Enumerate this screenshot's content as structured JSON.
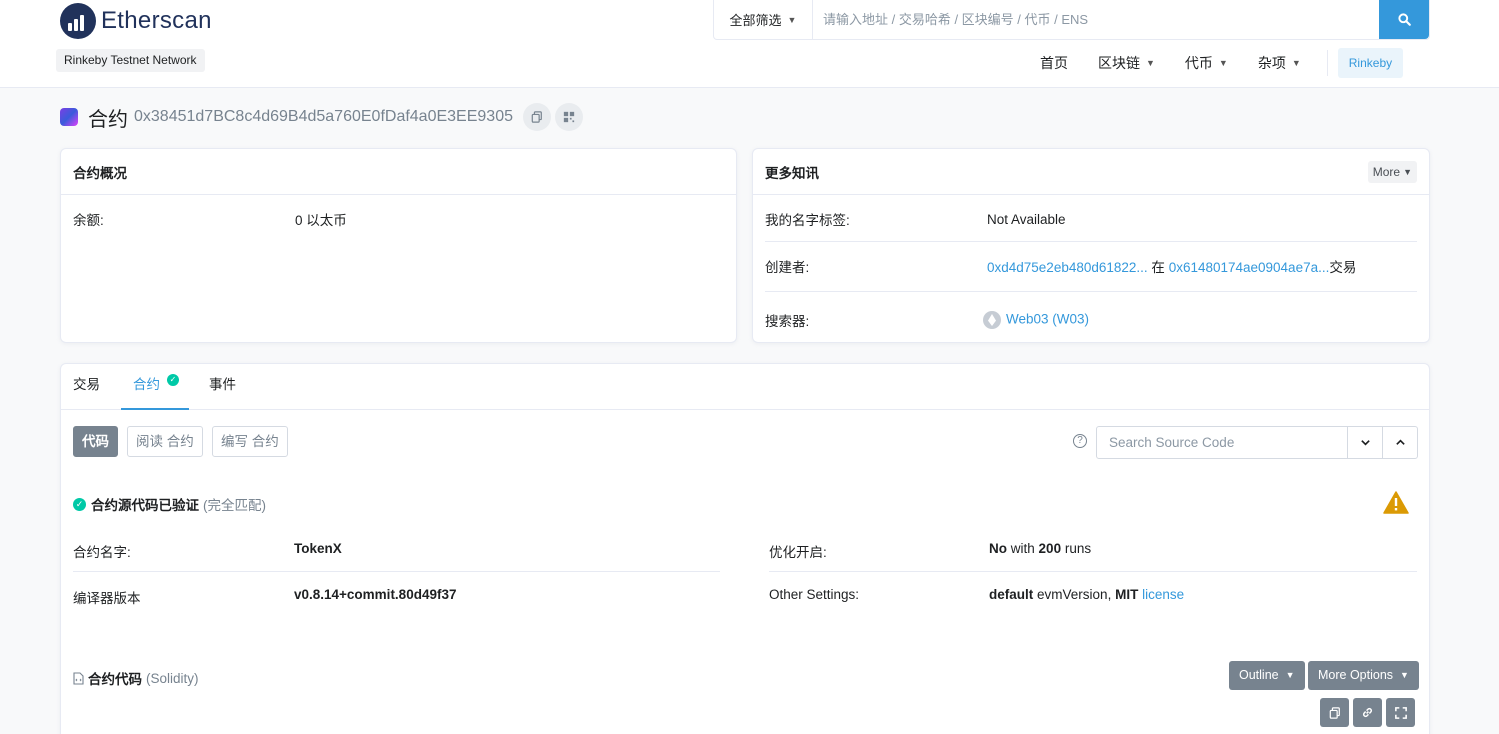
{
  "header": {
    "logo_text": "Etherscan",
    "network": "Rinkeby Testnet Network",
    "search": {
      "filter_label": "全部筛选",
      "placeholder": "请输入地址 / 交易哈希 / 区块编号 / 代币 / ENS"
    },
    "nav": [
      {
        "label": "首页"
      },
      {
        "label": "区块链"
      },
      {
        "label": "代币"
      },
      {
        "label": "杂项"
      }
    ],
    "network_button": "Rinkeby"
  },
  "page": {
    "title": "合约",
    "address": "0x38451d7BC8c4d69B4d5a760E0fDaf4a0E3EE9305"
  },
  "overview": {
    "header": "合约概况",
    "balance_label": "余额:",
    "balance_value": "0 以太币"
  },
  "more_info": {
    "header": "更多知讯",
    "more_button": "More",
    "name_tag_label": "我的名字标签:",
    "name_tag_value": "Not Available",
    "creator_label": "创建者:",
    "creator_address": "0xd4d75e2eb480d61822...",
    "creator_in": "在",
    "creator_tx": "0x61480174ae0904ae7a...",
    "creator_tx_suffix": "交易",
    "tracker_label": "搜索器:",
    "tracker_value": "Web03 (W03)"
  },
  "tabs": [
    {
      "label": "交易"
    },
    {
      "label": "合约"
    },
    {
      "label": "事件"
    }
  ],
  "code_tabs": [
    {
      "label": "代码"
    },
    {
      "label": "阅读 合约"
    },
    {
      "label": "编写 合约"
    }
  ],
  "source_search": {
    "placeholder": "Search Source Code"
  },
  "verified": {
    "title": "合约源代码已验证",
    "subtitle": "(完全匹配)"
  },
  "contract_info": {
    "name_label": "合约名字:",
    "name_value": "TokenX",
    "compiler_label": "编译器版本",
    "compiler_value": "v0.8.14+commit.80d49f37",
    "opt_label": "优化开启:",
    "opt_value": "No",
    "opt_with": "with",
    "opt_runs": "200",
    "opt_runs_suffix": "runs",
    "other_label": "Other Settings:",
    "other_default": "default",
    "other_evm": "evmVersion,",
    "other_license_name": "MIT",
    "other_license_link": "license"
  },
  "source_code": {
    "title": "合约代码",
    "language": "(Solidity)",
    "outline_button": "Outline",
    "more_options_button": "More Options"
  }
}
